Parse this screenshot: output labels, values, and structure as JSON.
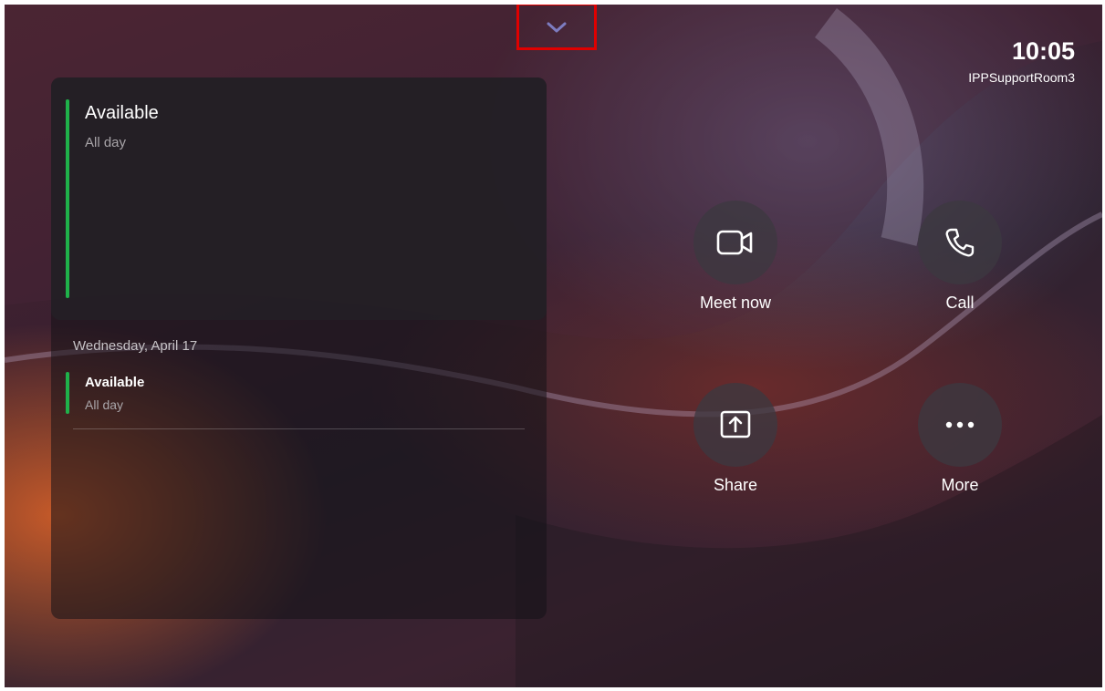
{
  "header": {
    "time": "10:05",
    "room_name": "IPPSupportRoom3",
    "collapse_handle_icon": "chevron-down-icon"
  },
  "calendar": {
    "current": {
      "status": "Available",
      "duration": "All day",
      "status_color": "#1fb14a"
    },
    "upcoming_date": "Wednesday, April 17",
    "upcoming": [
      {
        "status": "Available",
        "duration": "All day",
        "status_color": "#1fb14a"
      }
    ]
  },
  "actions": [
    {
      "label": "Meet now",
      "icon": "video-camera-icon"
    },
    {
      "label": "Call",
      "icon": "phone-icon"
    },
    {
      "label": "Share",
      "icon": "share-screen-icon"
    },
    {
      "label": "More",
      "icon": "more-options-icon"
    }
  ],
  "colors": {
    "accent_available": "#1fb14a",
    "chevron": "#7d7cc0",
    "highlight": "#e00000"
  }
}
